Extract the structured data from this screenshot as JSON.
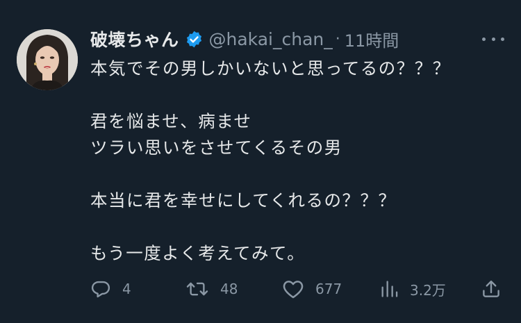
{
  "author": {
    "display_name": "破壊ちゃん",
    "handle": "@hakai_chan_",
    "separator": "·",
    "timestamp": "11時間",
    "verified_icon": "verified-badge-icon"
  },
  "tweet": {
    "lines": [
      "本気でその男しかいないと思ってるの？？？",
      "",
      "君を悩ませ、病ませ",
      "ツラい思いをさせてくるその男",
      "",
      "本当に君を幸せにしてくれるの？？？",
      "",
      "もう一度よく考えてみて。"
    ]
  },
  "actions": {
    "reply": {
      "icon": "reply-icon",
      "count": "4"
    },
    "retweet": {
      "icon": "retweet-icon",
      "count": "48"
    },
    "like": {
      "icon": "heart-icon",
      "count": "677"
    },
    "views": {
      "icon": "views-icon",
      "count": "3.2万"
    },
    "share": {
      "icon": "share-icon"
    }
  },
  "colors": {
    "background": "#15202b",
    "text_primary": "#e7e9ea",
    "text_secondary": "#8b98a5",
    "verified": "#1d9bf0"
  }
}
